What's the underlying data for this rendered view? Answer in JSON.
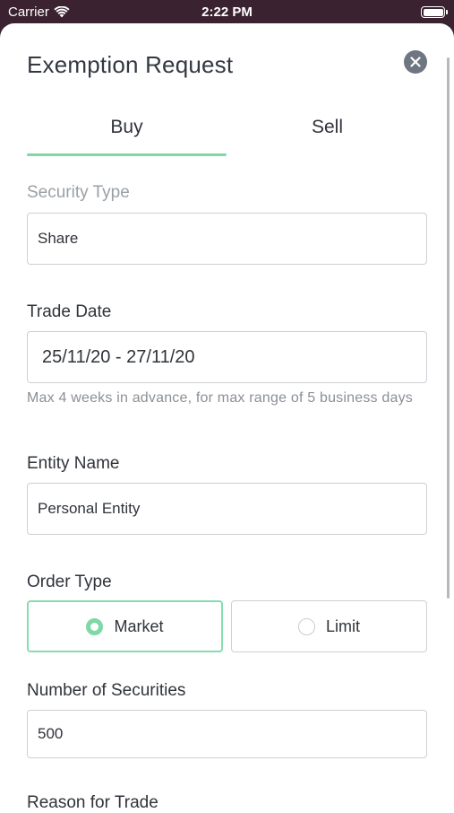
{
  "status_bar": {
    "carrier": "Carrier",
    "time": "2:22 PM"
  },
  "header": {
    "title": "Exemption Request",
    "close_icon": "close-icon"
  },
  "tabs": [
    {
      "label": "Buy",
      "active": true
    },
    {
      "label": "Sell",
      "active": false
    }
  ],
  "security_type": {
    "label": "Security Type",
    "value": "Share"
  },
  "trade_date": {
    "label": "Trade Date",
    "value": "25/11/20 - 27/11/20",
    "helper": "Max 4 weeks in advance, for max range of 5 business days"
  },
  "entity_name": {
    "label": "Entity Name",
    "value": "Personal Entity"
  },
  "order_type": {
    "label": "Order Type",
    "options": [
      {
        "label": "Market",
        "selected": true
      },
      {
        "label": "Limit",
        "selected": false
      }
    ]
  },
  "number_of_securities": {
    "label": "Number of Securities",
    "value": "500"
  },
  "reason_for_trade": {
    "label": "Reason for Trade"
  },
  "colors": {
    "accent": "#7ed9a6",
    "background": "#3b2230",
    "close_button": "#6e7681"
  }
}
